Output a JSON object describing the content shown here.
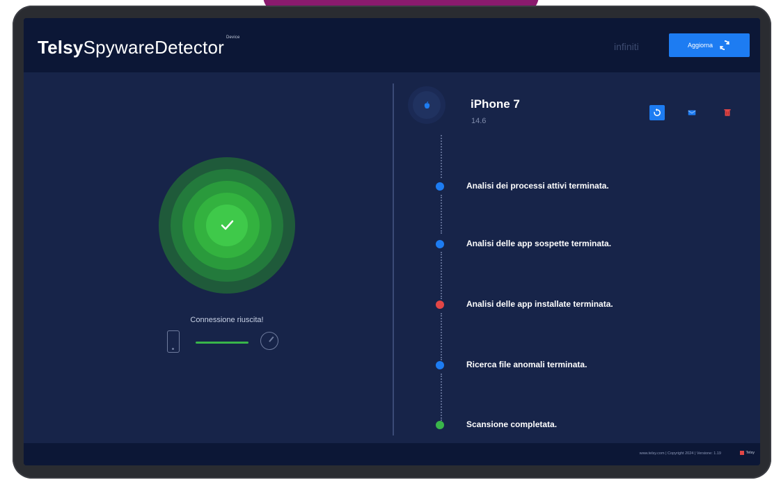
{
  "app": {
    "brand_bold": "Telsy",
    "brand_light": "SpywareDetector",
    "brand_sup": "Device",
    "license": "infiniti",
    "update_label": "Aggiorna"
  },
  "left": {
    "status_label": "Connessione riuscita!",
    "ring_color": "#39b54a"
  },
  "device": {
    "name": "iPhone 7",
    "version": "14.6"
  },
  "steps": [
    {
      "label": "Analisi dei processi attivi terminata.",
      "status": "done",
      "color": "#1d7cf2"
    },
    {
      "label": "Analisi delle app sospette terminata.",
      "status": "done",
      "color": "#1d7cf2"
    },
    {
      "label": "Analisi delle app installate terminata.",
      "status": "alert",
      "color": "#e24646"
    },
    {
      "label": "Ricerca file anomali terminata.",
      "status": "done",
      "color": "#1d7cf2"
    },
    {
      "label": "Scansione completata.",
      "status": "complete",
      "color": "#39b54a"
    }
  ],
  "footer": {
    "text": "www.telsy.com | Copyright 2024 | Versione: 1.19",
    "logo": "Telsy"
  },
  "icons": {
    "update": "refresh-icon",
    "check": "check-icon",
    "avatar": "apple-icon",
    "actions": [
      "refresh-icon",
      "mail-icon",
      "trash-icon"
    ]
  }
}
